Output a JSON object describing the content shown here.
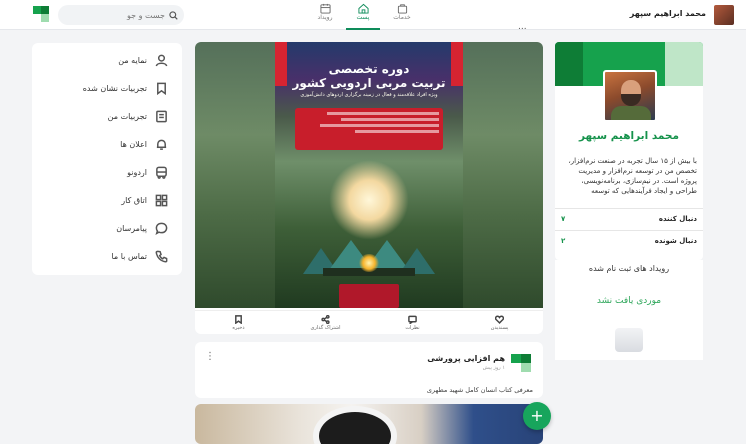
{
  "header": {
    "search_placeholder": "جست و جو",
    "tabs": [
      {
        "label": "رویداد",
        "icon": "calendar-icon"
      },
      {
        "label": "پست",
        "icon": "home-icon"
      },
      {
        "label": "خدمات",
        "icon": "bag-icon"
      }
    ],
    "user_name": "محمد ابراهیم سپهر",
    "more": "..."
  },
  "sidebar": {
    "items": [
      {
        "label": "نمایه من",
        "icon": "user-icon"
      },
      {
        "label": "تجربیات نشان شده",
        "icon": "bookmark-icon"
      },
      {
        "label": "تجربیات من",
        "icon": "document-icon"
      },
      {
        "label": "اعلان ها",
        "icon": "bell-icon"
      },
      {
        "label": "اردونو",
        "icon": "bus-icon"
      },
      {
        "label": "اتاق کار",
        "icon": "grid-icon"
      },
      {
        "label": "پیامرسان",
        "icon": "chat-icon"
      },
      {
        "label": "تماس با ما",
        "icon": "phone-icon"
      }
    ]
  },
  "post": {
    "poster_title_1": "دوره تخصصی",
    "poster_title_2": "تربیت مربی اردویی کشور",
    "poster_subtitle": "ویژه افراد علاقه‌مند و فعال در زمینه برگزاری اردوهای دانش‌آموزی",
    "actions": [
      {
        "label": "پسندیدن",
        "icon": "heart-icon"
      },
      {
        "label": "نظرات",
        "icon": "comment-icon"
      },
      {
        "label": "اشتراک گذاری",
        "icon": "share-icon"
      },
      {
        "label": "ذخیره",
        "icon": "save-icon"
      }
    ]
  },
  "post2": {
    "author": "هم افزایی پرورشی",
    "time": "۱ روز پیش",
    "text": "معرفی کتاب انسان کامل شهید مطهری"
  },
  "fab_label": "+",
  "profile": {
    "name": "محمد ابراهیم سپهر",
    "bio": "با بیش از ۱۵ سال تجربه در صنعت نرم‌افزار، تخصص من در توسعه نرم‌افزار و مدیریت پروژه است. در نیم‌سازی، برنامه‌نویسی، طراحی و ایجاد فرآیندهایی که توسعه",
    "followers_label": "دنبال کننده",
    "followers": "۷",
    "following_label": "دنبال شونده",
    "following": "۲"
  },
  "events": {
    "title": "رویداد های ثبت نام شده",
    "empty": "موردی یافت نشد"
  },
  "colors": {
    "accent": "#15924b",
    "fab": "#17a55c",
    "poster_red": "#d62431"
  }
}
